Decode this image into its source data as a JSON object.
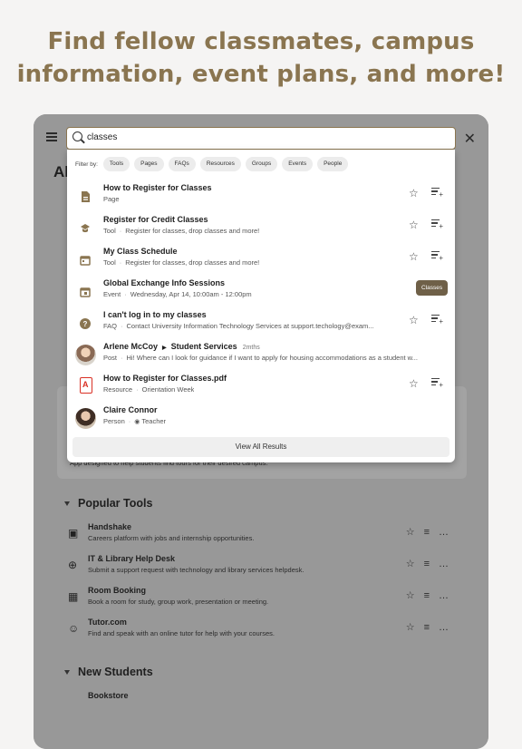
{
  "headline": "Find fellow classmates, campus information, event plans, and more!",
  "headline_lines": [
    "Find fellow classmates, campus",
    "information, event plans, and more!"
  ],
  "page_title": "Al",
  "search": {
    "value": "classes"
  },
  "filters": {
    "label": "Filter by:",
    "chips": [
      "Tools",
      "Pages",
      "FAQs",
      "Resources",
      "Groups",
      "Events",
      "People"
    ]
  },
  "results": [
    {
      "title": "How to Register for Classes",
      "type": "Page",
      "desc": "",
      "icon": "page-icon"
    },
    {
      "title": "Register for Credit Classes",
      "type": "Tool",
      "desc": "Register for classes, drop classes and more!",
      "icon": "tool-icon"
    },
    {
      "title": "My Class Schedule",
      "type": "Tool",
      "desc": "Register for classes, drop classes and more!",
      "icon": "calendar-icon"
    },
    {
      "title": "Global Exchange Info Sessions",
      "type": "Event",
      "desc": "Wednesday, Apr 14, 10:00am - 12:00pm",
      "icon": "event-icon"
    },
    {
      "title": "I can't log in to my classes",
      "type": "FAQ",
      "desc": "Contact University Information Technology Services at support.techology@exam...",
      "icon": "help-icon"
    },
    {
      "title": "Arlene McCoy",
      "group": "Student Services",
      "time": "2mths",
      "type": "Post",
      "desc": "Hi! Where can I look for guidance if I want to apply for housing accommodations as a student w...",
      "icon": "avatar"
    },
    {
      "title": "How to Register for Classes.pdf",
      "type": "Resource",
      "desc": "Orientation Week",
      "icon": "pdf-icon"
    },
    {
      "title": "Claire Connor",
      "type": "Person",
      "desc": "Teacher",
      "icon": "avatar"
    }
  ],
  "tooltip": "Classes",
  "view_all": "View All Results",
  "background": {
    "partial_desc": "App designed to help students find tours for their desired campus.",
    "popular_tools_title": "Popular Tools",
    "tools": [
      {
        "name": "Handshake",
        "desc": "Careers platform with jobs and internship opportunities.",
        "icon": "handshake-icon"
      },
      {
        "name": "IT & Library Help Desk",
        "desc": "Submit a support request with technology and library services helpdesk.",
        "icon": "globe-icon"
      },
      {
        "name": "Room Booking",
        "desc": "Book a room for study, group work, presentation or meeting.",
        "icon": "building-icon"
      },
      {
        "name": "Tutor.com",
        "desc": "Find and speak with an online tutor for help with your courses.",
        "icon": "tutor-icon"
      }
    ],
    "new_students_title": "New Students",
    "cut_item": "Bookstore"
  },
  "colors": {
    "accent": "#8a7550",
    "overlay": "#989898",
    "tooltip": "#6f6048"
  }
}
